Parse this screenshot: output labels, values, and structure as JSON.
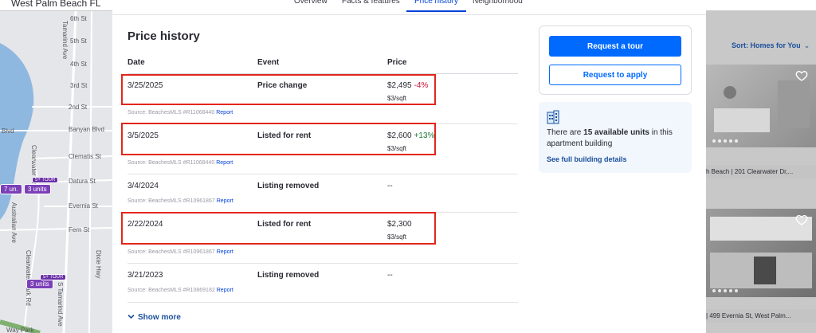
{
  "topbar": {
    "location": "West Palm Beach FL"
  },
  "map": {
    "streets": [
      "6th St",
      "5th St",
      "4th St",
      "3rd St",
      "2nd St",
      "Banyan Blvd",
      "Clematis St",
      "Datura St",
      "Evernia St",
      "Fern St",
      "Tamarind Ave",
      "Clearwater Dr",
      "Australian Ave",
      "Clearwater Park Rd",
      "S Tamarind Ave",
      "Dixie Hwy",
      "Way Park",
      "Blvd"
    ],
    "pins": [
      "7 un.",
      "3 units",
      "3 units",
      "5+ TOUR",
      "5+ TOUR"
    ]
  },
  "listings": {
    "sort_label": "Sort: Homes for You",
    "card1_text": "h Beach | 201 Clearwater Dr,...",
    "card2_text": "| 499 Evernia St, West Palm..."
  },
  "tabs": [
    "Overview",
    "Facts & features",
    "Price history",
    "Neighborhood"
  ],
  "price_history": {
    "title": "Price history",
    "columns": [
      "Date",
      "Event",
      "Price"
    ],
    "rows": [
      {
        "date": "3/25/2025",
        "event": "Price change",
        "price": "$2,495",
        "change": "-4%",
        "direction": "down",
        "per_sqft": "$3/sqft",
        "source": "Source: BeachesMLS  #R11068440",
        "report": "Report",
        "highlighted": true
      },
      {
        "date": "3/5/2025",
        "event": "Listed for rent",
        "price": "$2,600",
        "change": "+13%",
        "direction": "up",
        "per_sqft": "$3/sqft",
        "source": "Source: BeachesMLS  #R11068440",
        "report": "Report",
        "highlighted": true
      },
      {
        "date": "3/4/2024",
        "event": "Listing removed",
        "price": "--",
        "change": "",
        "direction": "",
        "per_sqft": "",
        "source": "Source: BeachesMLS  #R10961867",
        "report": "Report",
        "highlighted": false
      },
      {
        "date": "2/22/2024",
        "event": "Listed for rent",
        "price": "$2,300",
        "change": "",
        "direction": "",
        "per_sqft": "$3/sqft",
        "source": "Source: BeachesMLS  #R10961867",
        "report": "Report",
        "highlighted": true
      },
      {
        "date": "3/21/2023",
        "event": "Listing removed",
        "price": "--",
        "change": "",
        "direction": "",
        "per_sqft": "",
        "source": "Source: BeachesMLS  #R10869182",
        "report": "Report",
        "highlighted": false
      }
    ],
    "show_more": "Show more"
  },
  "side": {
    "tour_button": "Request a tour",
    "apply_button": "Request to apply",
    "units_prefix": "There are ",
    "units_count": "15 available units",
    "units_suffix": " in this apartment building",
    "units_link": "See full building details"
  },
  "colors": {
    "primary": "#006aff",
    "link": "#1b4f9c",
    "highlight": "#e4261b",
    "down": "#c8102e",
    "up": "#1f7a3a"
  }
}
